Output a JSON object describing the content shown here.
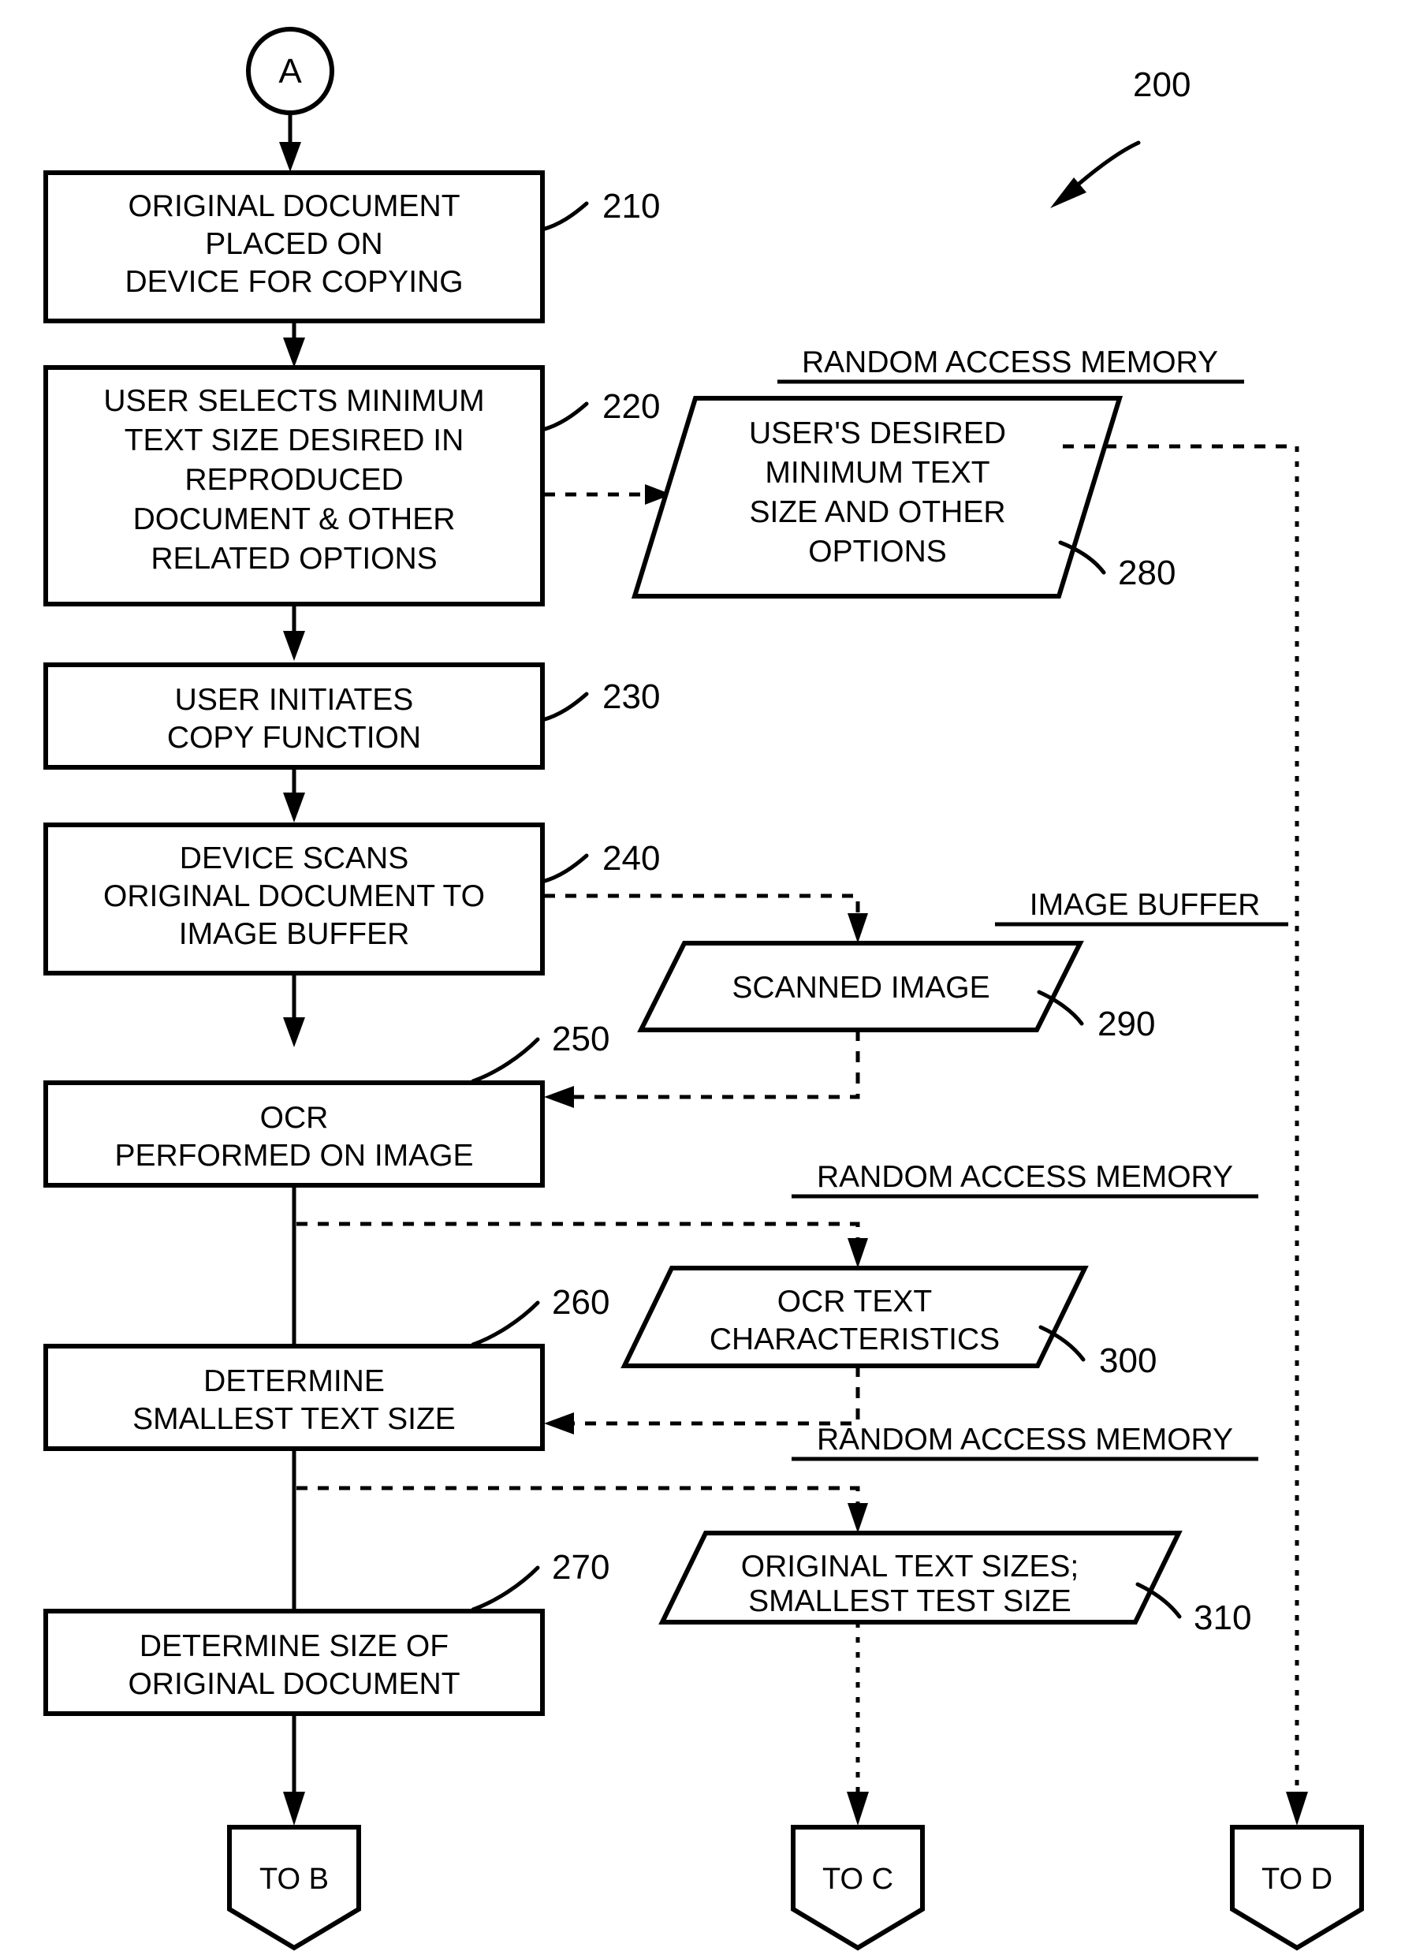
{
  "figure": {
    "figure_number": "200",
    "entry_connector": "A",
    "process_boxes": [
      {
        "ref": "210",
        "lines": [
          "ORIGINAL DOCUMENT",
          "PLACED ON",
          "DEVICE FOR COPYING"
        ]
      },
      {
        "ref": "220",
        "lines": [
          "USER SELECTS MINIMUM",
          "TEXT SIZE DESIRED IN",
          "REPRODUCED",
          "DOCUMENT & OTHER",
          "RELATED OPTIONS"
        ]
      },
      {
        "ref": "230",
        "lines": [
          "USER INITIATES",
          "COPY FUNCTION"
        ]
      },
      {
        "ref": "240",
        "lines": [
          "DEVICE SCANS",
          "ORIGINAL DOCUMENT TO",
          "IMAGE BUFFER"
        ]
      },
      {
        "ref": "250",
        "lines": [
          "OCR",
          "PERFORMED ON IMAGE"
        ]
      },
      {
        "ref": "260",
        "lines": [
          "DETERMINE",
          "SMALLEST TEXT SIZE"
        ]
      },
      {
        "ref": "270",
        "lines": [
          "DETERMINE SIZE OF",
          "ORIGINAL DOCUMENT"
        ]
      }
    ],
    "data_stores": [
      {
        "ref": "280",
        "header": "RANDOM ACCESS MEMORY",
        "lines": [
          "USER'S DESIRED",
          "MINIMUM TEXT",
          "SIZE AND OTHER",
          "OPTIONS"
        ]
      },
      {
        "ref": "290",
        "header": "IMAGE BUFFER",
        "lines": [
          "SCANNED IMAGE"
        ]
      },
      {
        "ref": "300",
        "header": "RANDOM ACCESS MEMORY",
        "lines": [
          "OCR TEXT",
          "CHARACTERISTICS"
        ]
      },
      {
        "ref": "310",
        "header": "RANDOM ACCESS MEMORY",
        "lines": [
          "ORIGINAL TEXT SIZES;",
          "SMALLEST TEST SIZE"
        ]
      }
    ],
    "exit_connectors": [
      {
        "label": "TO B"
      },
      {
        "label": "TO C"
      },
      {
        "label": "TO D"
      }
    ],
    "colors": {
      "ink": "#000000",
      "paper": "#ffffff"
    }
  }
}
